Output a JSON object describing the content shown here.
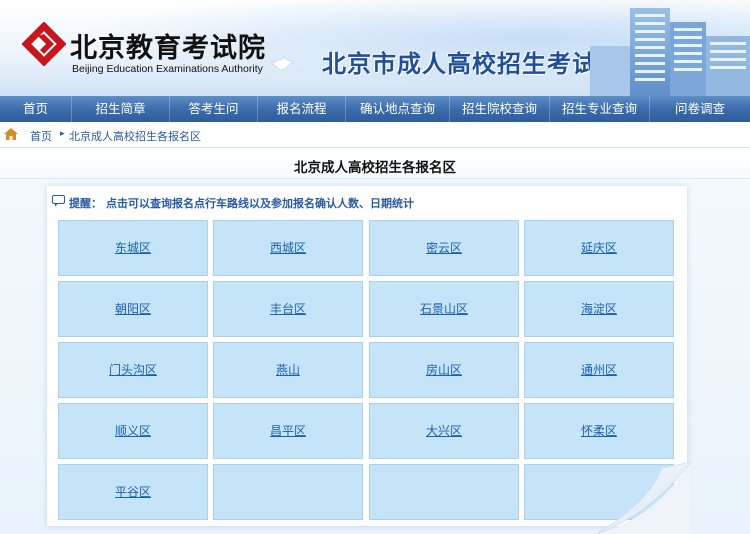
{
  "header": {
    "logo_cn": "北京教育考试院",
    "logo_en": "Beijing Education Examinations Authority",
    "site_title": "北京市成人高校招生考试网上报名"
  },
  "nav": {
    "items": [
      {
        "label": "首页"
      },
      {
        "label": "招生简章"
      },
      {
        "label": "答考生问"
      },
      {
        "label": "报名流程"
      },
      {
        "label": "确认地点查询"
      },
      {
        "label": "招生院校查询"
      },
      {
        "label": "招生专业查询"
      },
      {
        "label": "问卷调查"
      }
    ]
  },
  "breadcrumb": {
    "home": "首页",
    "separator": "▸",
    "current": "北京成人高校招生各报名区"
  },
  "main": {
    "title": "北京成人高校招生各报名区",
    "tip_label": "提醒：",
    "tip_text": "点击可以查询报名点行车路线以及参加报名确认人数、日期统计",
    "districts": [
      {
        "label": "东城区"
      },
      {
        "label": "西城区"
      },
      {
        "label": "密云区"
      },
      {
        "label": "延庆区"
      },
      {
        "label": "朝阳区"
      },
      {
        "label": "丰台区"
      },
      {
        "label": "石景山区"
      },
      {
        "label": "海淀区"
      },
      {
        "label": "门头沟区"
      },
      {
        "label": "燕山"
      },
      {
        "label": "房山区"
      },
      {
        "label": "通州区"
      },
      {
        "label": "顺义区"
      },
      {
        "label": "昌平区"
      },
      {
        "label": "大兴区"
      },
      {
        "label": "怀柔区"
      },
      {
        "label": "平谷区"
      }
    ]
  },
  "colors": {
    "nav_bg": "#3c6cac",
    "cell_bg": "#c5e4f8",
    "link": "#1f5fb0",
    "logo_red": "#c8161d"
  }
}
